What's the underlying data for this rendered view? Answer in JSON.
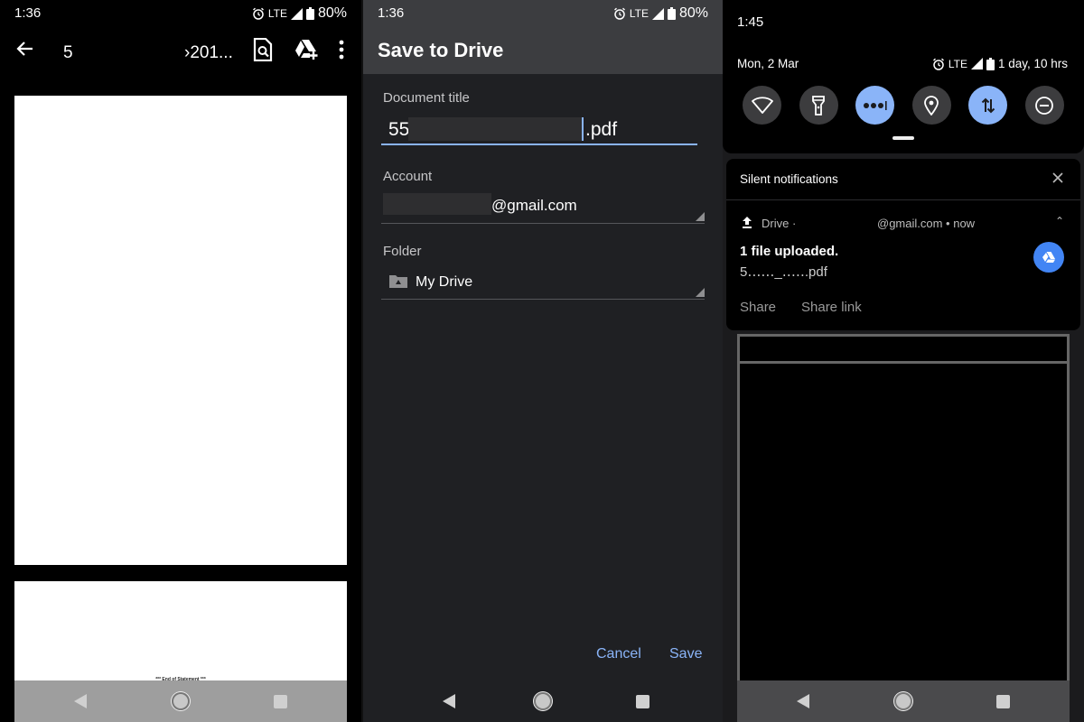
{
  "panels": {
    "viewer": {
      "status": {
        "time": "1:36",
        "network": "LTE",
        "battery": "80%"
      },
      "title_left": "5",
      "title_right": "›201...",
      "actions": [
        "find-in-page",
        "add-to-drive",
        "more-options"
      ],
      "page_footer_text": "*** End of Statement ***"
    },
    "save_dialog": {
      "status": {
        "time": "1:36",
        "network": "LTE",
        "battery": "80%"
      },
      "title": "Save to Drive",
      "document_title_label": "Document title",
      "document_title_prefix": "55",
      "document_title_suffix": ".pdf",
      "account_label": "Account",
      "account_value_suffix": "@gmail.com",
      "folder_label": "Folder",
      "folder_value": "My Drive",
      "cancel_label": "Cancel",
      "save_label": "Save",
      "accent_color": "#8ab4f8"
    },
    "notification_shade": {
      "time": "1:45",
      "date": "Mon, 2 Mar",
      "network": "LTE",
      "battery_text": "1 day, 10 hrs",
      "quick_settings": [
        {
          "name": "wifi",
          "active": false
        },
        {
          "name": "flashlight",
          "active": false
        },
        {
          "name": "more",
          "active": true
        },
        {
          "name": "location",
          "active": false
        },
        {
          "name": "mobile-data",
          "active": true
        },
        {
          "name": "do-not-disturb",
          "active": false
        }
      ],
      "section_title": "Silent notifications",
      "notification": {
        "app": "Drive ·",
        "account_meta": "@gmail.com • now",
        "title": "1 file uploaded.",
        "filename": "5․․․․․․_․․․․․.pdf",
        "actions": [
          "Share",
          "Share link"
        ]
      },
      "active_tile_color": "#8ab4f8",
      "drive_button_color": "#4285f4"
    }
  }
}
